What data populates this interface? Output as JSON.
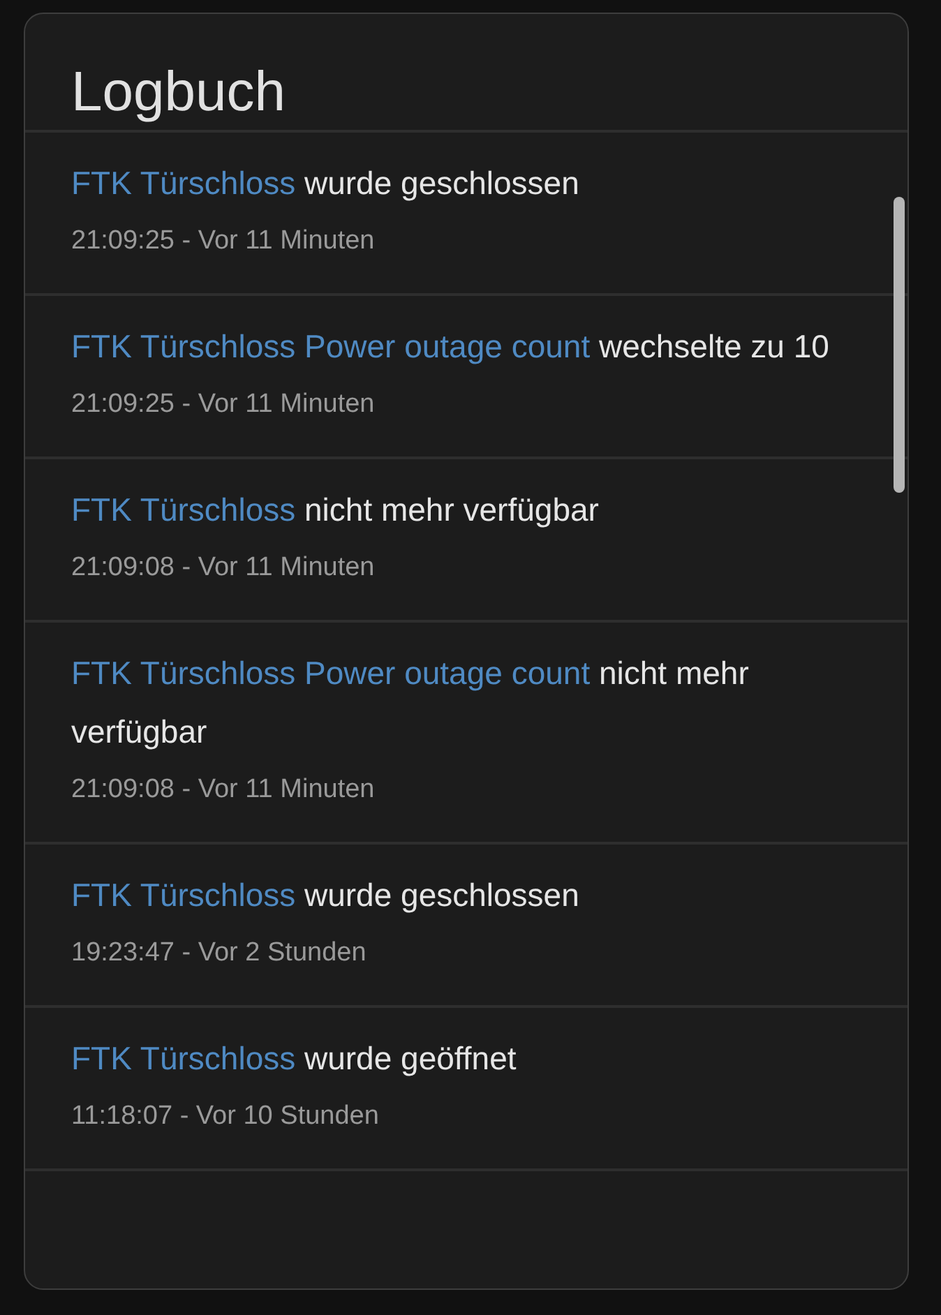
{
  "card": {
    "title": "Logbuch"
  },
  "entries": [
    {
      "entity": "FTK Türschloss",
      "message": "wurde geschlossen",
      "time": "21:09:25 - Vor 11 Minuten"
    },
    {
      "entity": "FTK Türschloss Power outage count",
      "message": "wechselte zu 10",
      "time": "21:09:25 - Vor 11 Minuten"
    },
    {
      "entity": "FTK Türschloss",
      "message": "nicht mehr verfügbar",
      "time": "21:09:08 - Vor 11 Minuten"
    },
    {
      "entity": "FTK Türschloss Power outage count",
      "message": "nicht mehr verfügbar",
      "time": "21:09:08 - Vor 11 Minuten"
    },
    {
      "entity": "FTK Türschloss",
      "message": "wurde geschlossen",
      "time": "19:23:47 - Vor 2 Stunden"
    },
    {
      "entity": "FTK Türschloss",
      "message": "wurde geöffnet",
      "time": "11:18:07 - Vor 10 Stunden"
    }
  ]
}
